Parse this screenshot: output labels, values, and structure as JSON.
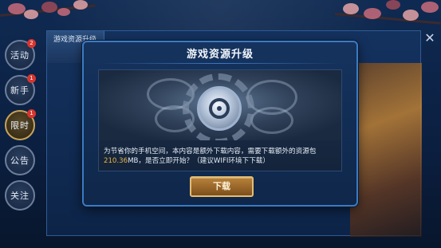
{
  "sidebar": {
    "items": [
      {
        "label": "活动",
        "badge": "2",
        "active": false
      },
      {
        "label": "新手",
        "badge": "1",
        "active": false
      },
      {
        "label": "限时",
        "badge": "1",
        "active": true
      },
      {
        "label": "公告",
        "badge": "",
        "active": false
      },
      {
        "label": "关注",
        "badge": "",
        "active": false
      }
    ]
  },
  "back_panel": {
    "tab_label": "游戏资源升级"
  },
  "modal": {
    "title": "游戏资源升级",
    "message_before": "为节省你的手机空间，本内容是额外下载内容，需要下载额外的资源包",
    "size": "210.36",
    "message_after": "MB，是否立即开始？（建议WIFI环境下下载）",
    "download_label": "下载"
  },
  "colors": {
    "highlight": "#e6b248",
    "modal_border": "#3c7ac2",
    "button": "#b8823a"
  },
  "icons": {
    "close": "close-icon",
    "emblem": "resource-emblem-icon"
  }
}
